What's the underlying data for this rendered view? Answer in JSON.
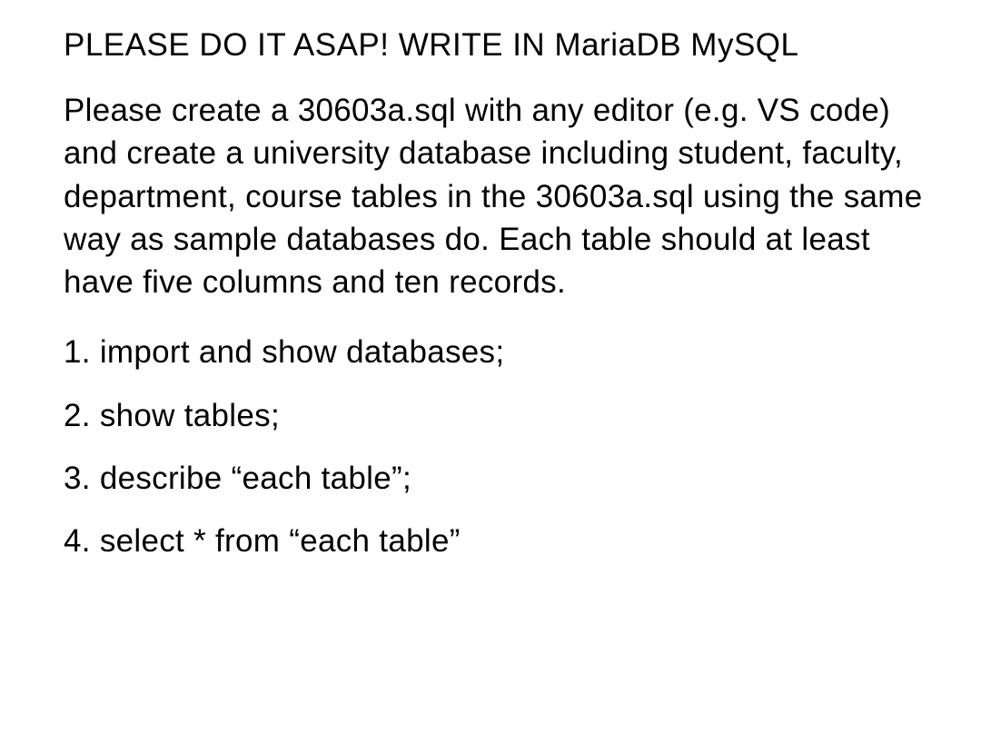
{
  "heading": "PLEASE DO IT ASAP! WRITE IN MariaDB MySQL",
  "paragraph": "Please create a 30603a.sql with any editor (e.g. VS code) and create a university database including student, faculty, department, course tables in the 30603a.sql using the same way as sample databases do. Each table should at least have five columns and ten records.",
  "items": {
    "item1": "1. import and show databases;",
    "item2": "2. show tables;",
    "item3": "3. describe “each table”;",
    "item4": "4. select * from “each table”"
  }
}
